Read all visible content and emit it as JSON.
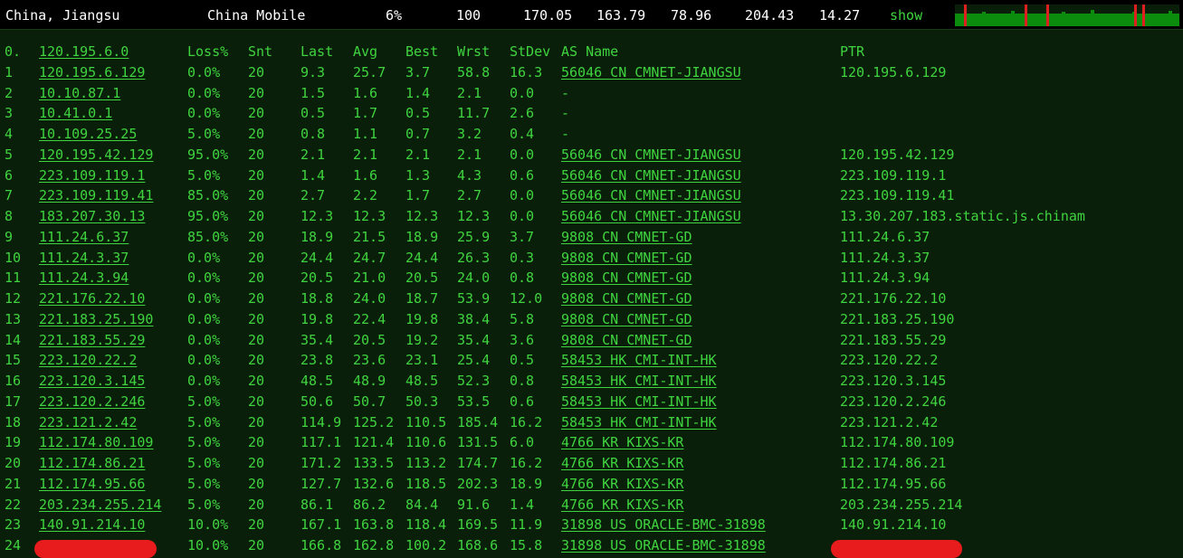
{
  "summary": {
    "location": "China, Jiangsu",
    "isp": "China Mobile",
    "loss": "6%",
    "sent": "100",
    "last": "170.05",
    "avg": "163.79",
    "best": "78.96",
    "worst": "204.43",
    "stdev": "14.27",
    "show_label": "show",
    "graph_colors": {
      "base": "#0c8c0c",
      "spike": "#e02020"
    }
  },
  "headers": {
    "num": "0.",
    "host": "120.195.6.0",
    "loss": "Loss%",
    "snt": "Snt",
    "last": "Last",
    "avg": "Avg",
    "best": "Best",
    "wrst": "Wrst",
    "stdev": "StDev",
    "as": "AS Name",
    "ptr": "PTR"
  },
  "hops": [
    {
      "n": "1",
      "host": "120.195.6.129",
      "loss": "0.0%",
      "snt": "20",
      "last": "9.3",
      "avg": "25.7",
      "best": "3.7",
      "wrst": "58.8",
      "stdev": "16.3",
      "as": "56046 CN CMNET-JIANGSU",
      "ptr": "120.195.6.129"
    },
    {
      "n": "2",
      "host": "10.10.87.1",
      "loss": "0.0%",
      "snt": "20",
      "last": "1.5",
      "avg": "1.6",
      "best": "1.4",
      "wrst": "2.1",
      "stdev": "0.0",
      "as": "-",
      "ptr": ""
    },
    {
      "n": "3",
      "host": "10.41.0.1",
      "loss": "0.0%",
      "snt": "20",
      "last": "0.5",
      "avg": "1.7",
      "best": "0.5",
      "wrst": "11.7",
      "stdev": "2.6",
      "as": "-",
      "ptr": ""
    },
    {
      "n": "4",
      "host": "10.109.25.25",
      "loss": "5.0%",
      "snt": "20",
      "last": "0.8",
      "avg": "1.1",
      "best": "0.7",
      "wrst": "3.2",
      "stdev": "0.4",
      "as": "-",
      "ptr": ""
    },
    {
      "n": "5",
      "host": "120.195.42.129",
      "loss": "95.0%",
      "snt": "20",
      "last": "2.1",
      "avg": "2.1",
      "best": "2.1",
      "wrst": "2.1",
      "stdev": "0.0",
      "as": "56046 CN CMNET-JIANGSU",
      "ptr": "120.195.42.129"
    },
    {
      "n": "6",
      "host": "223.109.119.1",
      "loss": "5.0%",
      "snt": "20",
      "last": "1.4",
      "avg": "1.6",
      "best": "1.3",
      "wrst": "4.3",
      "stdev": "0.6",
      "as": "56046 CN CMNET-JIANGSU",
      "ptr": "223.109.119.1"
    },
    {
      "n": "7",
      "host": "223.109.119.41",
      "loss": "85.0%",
      "snt": "20",
      "last": "2.7",
      "avg": "2.2",
      "best": "1.7",
      "wrst": "2.7",
      "stdev": "0.0",
      "as": "56046 CN CMNET-JIANGSU",
      "ptr": "223.109.119.41"
    },
    {
      "n": "8",
      "host": "183.207.30.13",
      "loss": "95.0%",
      "snt": "20",
      "last": "12.3",
      "avg": "12.3",
      "best": "12.3",
      "wrst": "12.3",
      "stdev": "0.0",
      "as": "56046 CN CMNET-JIANGSU",
      "ptr": "13.30.207.183.static.js.chinam"
    },
    {
      "n": "9",
      "host": "111.24.6.37",
      "loss": "85.0%",
      "snt": "20",
      "last": "18.9",
      "avg": "21.5",
      "best": "18.9",
      "wrst": "25.9",
      "stdev": "3.7",
      "as": "9808  CN CMNET-GD",
      "ptr": "111.24.6.37"
    },
    {
      "n": "10",
      "host": "111.24.3.37",
      "loss": "0.0%",
      "snt": "20",
      "last": "24.4",
      "avg": "24.7",
      "best": "24.4",
      "wrst": "26.3",
      "stdev": "0.3",
      "as": "9808  CN CMNET-GD",
      "ptr": "111.24.3.37"
    },
    {
      "n": "11",
      "host": "111.24.3.94",
      "loss": "0.0%",
      "snt": "20",
      "last": "20.5",
      "avg": "21.0",
      "best": "20.5",
      "wrst": "24.0",
      "stdev": "0.8",
      "as": "9808  CN CMNET-GD",
      "ptr": "111.24.3.94"
    },
    {
      "n": "12",
      "host": "221.176.22.10",
      "loss": "0.0%",
      "snt": "20",
      "last": "18.8",
      "avg": "24.0",
      "best": "18.7",
      "wrst": "53.9",
      "stdev": "12.0",
      "as": "9808  CN CMNET-GD",
      "ptr": "221.176.22.10"
    },
    {
      "n": "13",
      "host": "221.183.25.190",
      "loss": "0.0%",
      "snt": "20",
      "last": "19.8",
      "avg": "22.4",
      "best": "19.8",
      "wrst": "38.4",
      "stdev": "5.8",
      "as": "9808  CN CMNET-GD",
      "ptr": "221.183.25.190"
    },
    {
      "n": "14",
      "host": "221.183.55.29",
      "loss": "0.0%",
      "snt": "20",
      "last": "35.4",
      "avg": "20.5",
      "best": "19.2",
      "wrst": "35.4",
      "stdev": "3.6",
      "as": "9808  CN CMNET-GD",
      "ptr": "221.183.55.29"
    },
    {
      "n": "15",
      "host": "223.120.22.2",
      "loss": "0.0%",
      "snt": "20",
      "last": "23.8",
      "avg": "23.6",
      "best": "23.1",
      "wrst": "25.4",
      "stdev": "0.5",
      "as": "58453 HK CMI-INT-HK",
      "ptr": "223.120.22.2"
    },
    {
      "n": "16",
      "host": "223.120.3.145",
      "loss": "0.0%",
      "snt": "20",
      "last": "48.5",
      "avg": "48.9",
      "best": "48.5",
      "wrst": "52.3",
      "stdev": "0.8",
      "as": "58453 HK CMI-INT-HK",
      "ptr": "223.120.3.145"
    },
    {
      "n": "17",
      "host": "223.120.2.246",
      "loss": "5.0%",
      "snt": "20",
      "last": "50.6",
      "avg": "50.7",
      "best": "50.3",
      "wrst": "53.5",
      "stdev": "0.6",
      "as": "58453 HK CMI-INT-HK",
      "ptr": "223.120.2.246"
    },
    {
      "n": "18",
      "host": "223.121.2.42",
      "loss": "5.0%",
      "snt": "20",
      "last": "114.9",
      "avg": "125.2",
      "best": "110.5",
      "wrst": "185.4",
      "stdev": "16.2",
      "as": "58453 HK CMI-INT-HK",
      "ptr": "223.121.2.42"
    },
    {
      "n": "19",
      "host": "112.174.80.109",
      "loss": "5.0%",
      "snt": "20",
      "last": "117.1",
      "avg": "121.4",
      "best": "110.6",
      "wrst": "131.5",
      "stdev": "6.0",
      "as": "4766  KR KIXS-KR",
      "ptr": "112.174.80.109"
    },
    {
      "n": "20",
      "host": "112.174.86.21",
      "loss": "5.0%",
      "snt": "20",
      "last": "171.2",
      "avg": "133.5",
      "best": "113.2",
      "wrst": "174.7",
      "stdev": "16.2",
      "as": "4766  KR KIXS-KR",
      "ptr": "112.174.86.21"
    },
    {
      "n": "21",
      "host": "112.174.95.66",
      "loss": "5.0%",
      "snt": "20",
      "last": "127.7",
      "avg": "132.6",
      "best": "118.5",
      "wrst": "202.3",
      "stdev": "18.9",
      "as": "4766  KR KIXS-KR",
      "ptr": "112.174.95.66"
    },
    {
      "n": "22",
      "host": "203.234.255.214",
      "loss": "5.0%",
      "snt": "20",
      "last": "86.1",
      "avg": "86.2",
      "best": "84.4",
      "wrst": "91.6",
      "stdev": "1.4",
      "as": "4766  KR KIXS-KR",
      "ptr": "203.234.255.214"
    },
    {
      "n": "23",
      "host": "140.91.214.10",
      "loss": "10.0%",
      "snt": "20",
      "last": "167.1",
      "avg": "163.8",
      "best": "118.4",
      "wrst": "169.5",
      "stdev": "11.9",
      "as": "31898 US ORACLE-BMC-31898",
      "ptr": "140.91.214.10"
    },
    {
      "n": "24",
      "host": "",
      "loss": "10.0%",
      "snt": "20",
      "last": "166.8",
      "avg": "162.8",
      "best": "100.2",
      "wrst": "168.6",
      "stdev": "15.8",
      "as": "31898 US ORACLE-BMC-31898",
      "ptr": "",
      "redacted": true
    }
  ]
}
